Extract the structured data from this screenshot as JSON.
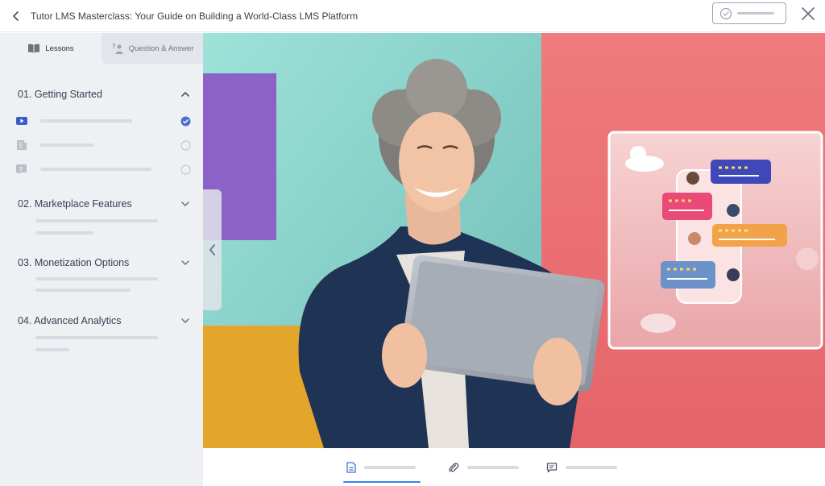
{
  "header": {
    "title": "Tutor LMS Masterclass: Your Guide on Building a World-Class LMS Platform",
    "complete_icon": "check-circle-icon",
    "close_icon": "close-icon",
    "back_icon": "chevron-left-icon"
  },
  "sidebar": {
    "tabs": [
      {
        "label": "Lessons",
        "icon": "book-icon",
        "active": true
      },
      {
        "label": "Question & Answer",
        "icon": "qa-icon",
        "active": false
      }
    ],
    "topics": [
      {
        "title": "01. Getting Started",
        "expanded": true,
        "lessons": [
          {
            "icon": "video-icon",
            "status": "completed"
          },
          {
            "icon": "document-icon",
            "status": "incomplete"
          },
          {
            "icon": "quiz-icon",
            "status": "incomplete"
          }
        ]
      },
      {
        "title": "02. Marketplace Features",
        "expanded": false
      },
      {
        "title": "03. Monetization Options",
        "expanded": false
      },
      {
        "title": "04. Advanced Analytics",
        "expanded": false
      }
    ]
  },
  "bottom_tabs": [
    {
      "icon": "file-text-icon",
      "active": true
    },
    {
      "icon": "paperclip-icon",
      "active": false
    },
    {
      "icon": "comment-icon",
      "active": false
    }
  ],
  "colors": {
    "accent": "#3b82f6",
    "check": "#4a6fd0",
    "video_teal": "#8ed2cc",
    "video_coral": "#ec6f73",
    "video_purple": "#8b5fc2",
    "video_yellow": "#e6a82b"
  }
}
